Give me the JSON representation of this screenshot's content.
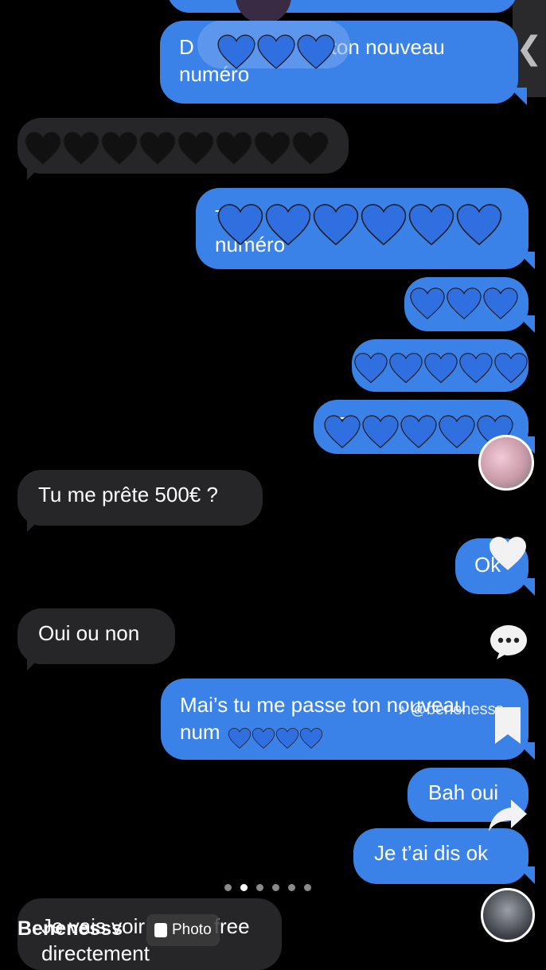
{
  "side_tab": {
    "icon": "chevron-left-icon",
    "glyph": "❮"
  },
  "messages": [
    {
      "id": "m1",
      "dir": "out",
      "text": "D                   se ton nouveau",
      "text2": "numéro"
    },
    {
      "id": "m2",
      "dir": "in",
      "text": ""
    },
    {
      "id": "m3",
      "dir": "out",
      "text": "T",
      "text2": "numéro"
    },
    {
      "id": "m4",
      "dir": "out",
      "text": ""
    },
    {
      "id": "m5",
      "dir": "out",
      "text": ""
    },
    {
      "id": "m6",
      "dir": "out",
      "text": "T"
    },
    {
      "id": "m7",
      "dir": "in",
      "text": "Tu me prête 500€ ?"
    },
    {
      "id": "m8",
      "dir": "out",
      "text": "Ok"
    },
    {
      "id": "m9",
      "dir": "in",
      "text": "Oui ou non"
    },
    {
      "id": "m10",
      "dir": "out",
      "text": "Mai’s tu me passe ton nouveau",
      "text2": "num"
    },
    {
      "id": "m11",
      "dir": "out",
      "text": "Bah oui"
    },
    {
      "id": "m12",
      "dir": "out",
      "text": "Je t’ai dis ok"
    },
    {
      "id": "m13",
      "dir": "in",
      "text": "Je vais voir            free",
      "text2": "directement"
    }
  ],
  "overlay": {
    "watermark": "@benenesss_",
    "username": "Benenesss",
    "photo_label": "Photo",
    "carousel_pages": 6,
    "carousel_active": 1
  },
  "icons": {
    "like": "heart-icon",
    "comment": "comment-icon",
    "bookmark": "bookmark-icon",
    "share": "share-icon"
  },
  "colors": {
    "outgoing": "#3b82e8",
    "incoming": "#262628",
    "heart_blue": "#2f6fe0",
    "heart_black": "#111111"
  }
}
